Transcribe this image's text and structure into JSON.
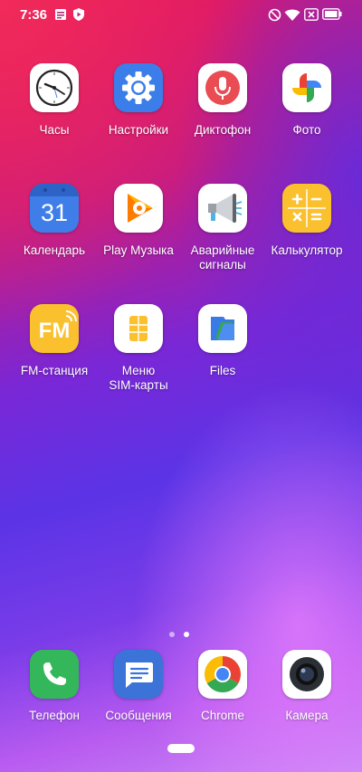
{
  "status_bar": {
    "time": "7:36",
    "icons": [
      "notification-icon",
      "shield-icon",
      "dnd-icon",
      "wifi-icon",
      "sim-icon",
      "battery-icon"
    ]
  },
  "apps": [
    {
      "label": "Часы",
      "icon": "clock-icon"
    },
    {
      "label": "Настройки",
      "icon": "gear-icon"
    },
    {
      "label": "Диктофон",
      "icon": "microphone-icon"
    },
    {
      "label": "Фото",
      "icon": "photos-pinwheel-icon"
    },
    {
      "label": "Календарь",
      "icon": "calendar-icon",
      "badge": "31"
    },
    {
      "label": "Play Музыка",
      "icon": "play-music-icon"
    },
    {
      "label": "Аварийные\nсигналы",
      "icon": "megaphone-icon"
    },
    {
      "label": "Калькулятор",
      "icon": "calculator-icon"
    },
    {
      "label": "FM-станция",
      "icon": "fm-radio-icon",
      "badge": "FM"
    },
    {
      "label": "Меню\nSIM-карты",
      "icon": "sim-card-icon"
    },
    {
      "label": "Files",
      "icon": "files-icon"
    }
  ],
  "page_indicator": {
    "pages": 2,
    "current": 2
  },
  "dock": [
    {
      "label": "Телефон",
      "icon": "phone-icon"
    },
    {
      "label": "Сообщения",
      "icon": "messages-icon"
    },
    {
      "label": "Chrome",
      "icon": "chrome-icon"
    },
    {
      "label": "Камера",
      "icon": "camera-icon"
    }
  ],
  "colors": {
    "accent_blue": "#4285F4",
    "google_red": "#EA4335",
    "google_yellow": "#FBBC05",
    "google_green": "#34A853"
  }
}
